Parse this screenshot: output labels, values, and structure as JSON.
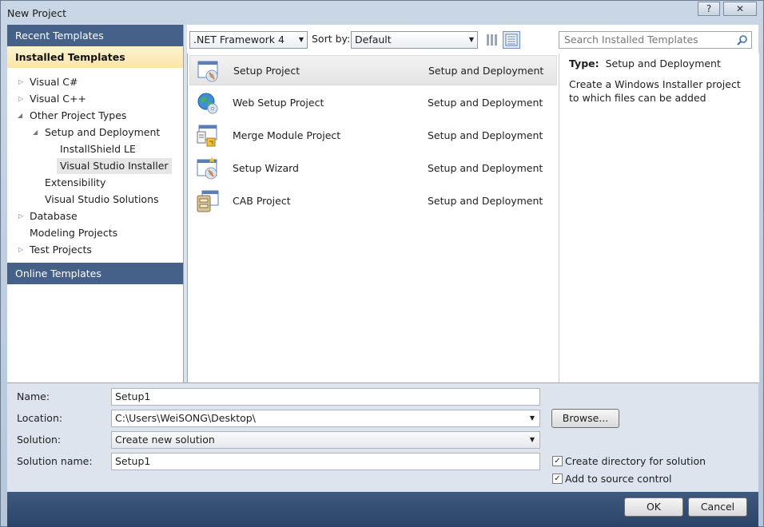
{
  "window": {
    "title": "New Project",
    "help_glyph": "?",
    "close_glyph": "✕"
  },
  "left": {
    "recent": "Recent Templates",
    "installed": "Installed Templates",
    "online": "Online Templates",
    "tree": [
      {
        "label": "Visual C#",
        "expanded": false
      },
      {
        "label": "Visual C++",
        "expanded": false
      },
      {
        "label": "Other Project Types",
        "expanded": true
      },
      {
        "label": "Setup and Deployment",
        "expanded": true
      },
      {
        "label": "InstallShield LE"
      },
      {
        "label": "Visual Studio Installer",
        "selected": true
      },
      {
        "label": "Extensibility"
      },
      {
        "label": "Visual Studio Solutions"
      },
      {
        "label": "Database",
        "expanded": false
      },
      {
        "label": "Modeling Projects"
      },
      {
        "label": "Test Projects",
        "expanded": false
      }
    ]
  },
  "toolbar": {
    "framework": ".NET Framework 4",
    "sort_label": "Sort by:",
    "sort_value": "Default",
    "search_placeholder": "Search Installed Templates"
  },
  "templates": [
    {
      "name": "Setup Project",
      "category": "Setup and Deployment",
      "icon": "setup-project-icon"
    },
    {
      "name": "Web Setup Project",
      "category": "Setup and Deployment",
      "icon": "web-setup-icon"
    },
    {
      "name": "Merge Module Project",
      "category": "Setup and Deployment",
      "icon": "merge-module-icon"
    },
    {
      "name": "Setup Wizard",
      "category": "Setup and Deployment",
      "icon": "setup-wizard-icon"
    },
    {
      "name": "CAB Project",
      "category": "Setup and Deployment",
      "icon": "cab-project-icon"
    }
  ],
  "details": {
    "type_label": "Type:",
    "type_value": "Setup and Deployment",
    "description": "Create a Windows Installer project to which files can be added"
  },
  "form": {
    "name_label": "Name:",
    "name_value": "Setup1",
    "location_label": "Location:",
    "location_value": "C:\\Users\\WeiSONG\\Desktop\\",
    "browse": "Browse...",
    "solution_label": "Solution:",
    "solution_value": "Create new solution",
    "solution_name_label": "Solution name:",
    "solution_name_value": "Setup1",
    "create_dir": "Create directory for solution",
    "add_source": "Add to source control"
  },
  "buttons": {
    "ok": "OK",
    "cancel": "Cancel"
  }
}
